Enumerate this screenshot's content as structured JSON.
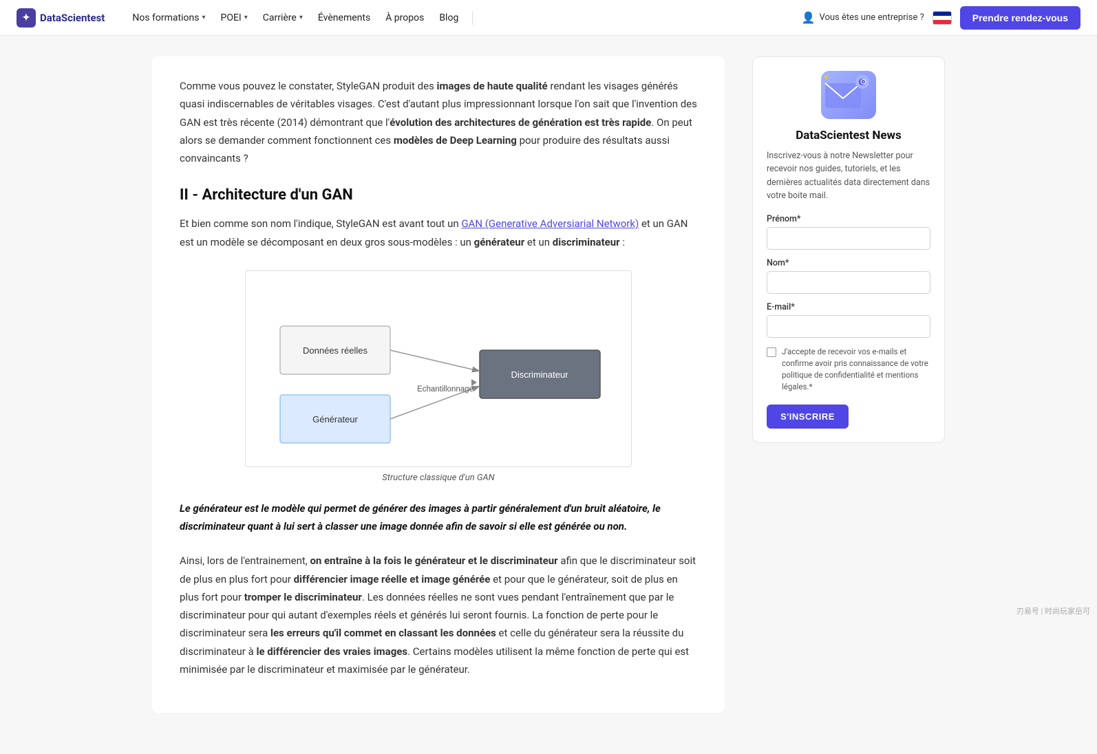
{
  "nav": {
    "logo_text": "DataScientest",
    "logo_icon": "✦",
    "links": [
      {
        "label": "Nos formations",
        "has_dropdown": true
      },
      {
        "label": "POEI",
        "has_dropdown": true
      },
      {
        "label": "Carrière",
        "has_dropdown": true
      },
      {
        "label": "Évènements",
        "has_dropdown": false
      },
      {
        "label": "À propos",
        "has_dropdown": false
      },
      {
        "label": "Blog",
        "has_dropdown": false
      }
    ],
    "enterprise_label": "Vous êtes une entreprise ?",
    "cta_label": "Prendre rendez-vous"
  },
  "main": {
    "intro_paragraph_1": "Comme vous pouvez le constater, StyleGAN produit des ",
    "intro_bold_1": "images de haute qualité",
    "intro_paragraph_1b": " rendant les visages générés quasi indiscernables de véritables visages. C'est d'autant plus impressionnant lorsque l'on sait que l'invention des GAN est très récente (2014) démontrant que l'",
    "intro_bold_2": "évolution des architectures de génération est très rapide",
    "intro_paragraph_1c": ". On peut alors se demander comment fonctionnent ces ",
    "intro_bold_3": "modèles de Deep Learning",
    "intro_paragraph_1d": " pour produire des résultats aussi convaincants ?",
    "section_heading": "II - Architecture d'un GAN",
    "body_paragraph_1a": "Et bien comme son nom l'indique, StyleGAN est avant tout un ",
    "body_link_text": "GAN (Generative Adversiarial Network)",
    "body_paragraph_1b": " et un GAN est un modèle se décomposant en deux gros sous-modèles : un ",
    "body_bold_1": "générateur",
    "body_paragraph_1c": " et un ",
    "body_bold_2": "discriminateur",
    "body_paragraph_1d": " :",
    "diagram": {
      "box1_label": "Données réelles",
      "box2_label": "Générateur",
      "box3_label": "Discriminateur",
      "arrow_label": "Echantillonnage",
      "caption": "Structure classique d'un GAN"
    },
    "quote_text": "Le générateur est le modèle qui permet de générer des images à partir généralement d'un bruit aléatoire, le discriminateur quant à lui sert à classer une image donnée afin de savoir si elle est générée ou non.",
    "body_paragraph_2a": "Ainsi, lors de l'entrainement, ",
    "body_paragraph_2_bold1": "on entraîne à la fois le générateur et le discriminateur",
    "body_paragraph_2b": " afin que le discriminateur soit de plus en plus fort pour ",
    "body_paragraph_2_bold2": "différencier image réelle et image générée",
    "body_paragraph_2c": " et pour que le générateur, soit de plus en plus fort pour ",
    "body_paragraph_2_bold3": "tromper le discriminateur",
    "body_paragraph_2d": ". Les données réelles ne sont vues pendant l'entraînement que par le discriminateur pour qui autant d'exemples réels et générés lui seront fournis. La fonction de perte pour le discriminateur sera ",
    "body_paragraph_2_bold4": "les erreurs qu'il commet en classant les données",
    "body_paragraph_2e": " et celle du générateur sera la réussite du discriminateur à ",
    "body_paragraph_2_bold5": "le différencier des vraies images",
    "body_paragraph_2f": ". Certains modèles utilisent la même fonction de perte qui est minimisée par le discriminateur et maximisée par le générateur."
  },
  "sidebar": {
    "newsletter_title": "DataScientest News",
    "newsletter_desc": "Inscrivez-vous à notre Newsletter pour recevoir nos guides, tutoriels, et les dernières actualités data directement dans votre boite mail.",
    "form": {
      "prenom_label": "Prénom*",
      "prenom_placeholder": "",
      "nom_label": "Nom*",
      "nom_placeholder": "",
      "email_label": "E-mail*",
      "email_placeholder": "",
      "consent_text": "J'accepte de recevoir vos e-mails et confirme avoir pris connaissance de votre politique de confidentialité et mentions légales.*",
      "submit_label": "S'INSCRIRE"
    }
  }
}
